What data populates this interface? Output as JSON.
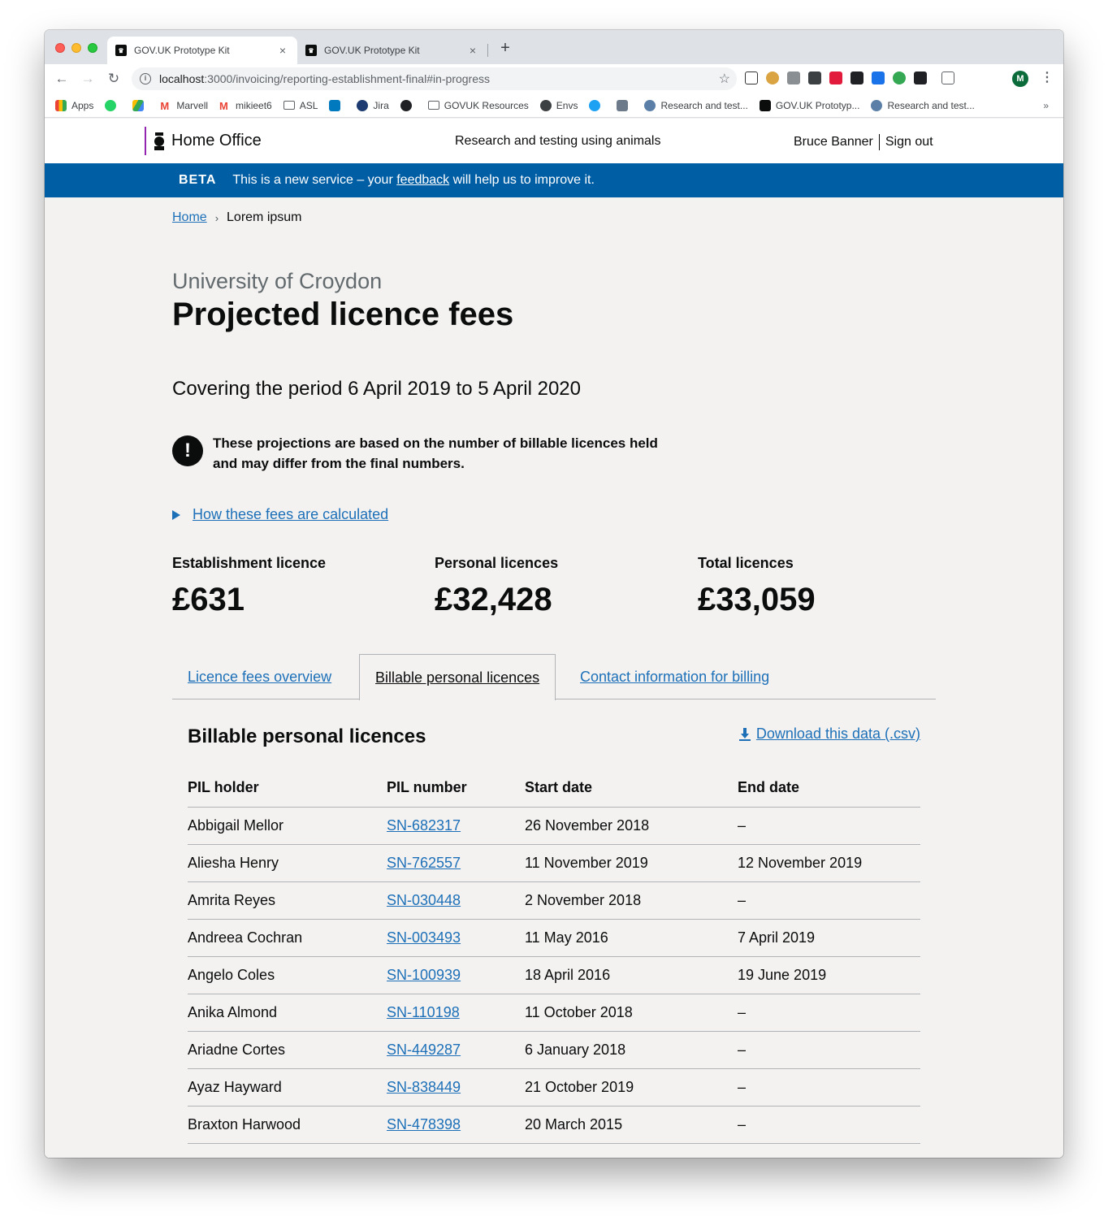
{
  "browser": {
    "tabs": [
      {
        "title": "GOV.UK Prototype Kit",
        "favicon": "crown-icon"
      },
      {
        "title": "GOV.UK Prototype Kit",
        "favicon": "crown-icon"
      }
    ],
    "close_glyph": "×",
    "new_tab_glyph": "+",
    "url_host": "localhost",
    "url_path": ":3000/invoicing/reporting-establishment-final#in-progress",
    "profile_initial": "M",
    "bookmarks": [
      "Apps",
      "Marvell",
      "mikieet6",
      "ASL",
      "Jira",
      "GOVUK Resources",
      "Envs",
      "Research and test...",
      "GOV.UK Prototyp...",
      "Research and test..."
    ],
    "bookmarks_more": "»"
  },
  "header": {
    "logo_text": "Home Office",
    "service_name": "Research and testing using animals",
    "user_name": "Bruce Banner",
    "sign_out": "Sign out"
  },
  "beta": {
    "tag": "BETA",
    "text_before": "This is a new service – your",
    "link": "feedback",
    "text_after": "will help us to improve it."
  },
  "breadcrumb": {
    "home": "Home",
    "current": "Lorem ipsum"
  },
  "page": {
    "caption": "University of Croydon",
    "title": "Projected licence fees",
    "period": "Covering the period 6 April 2019 to 5 April 2020",
    "warning_icon": "!",
    "warning": "These projections are based on the number of billable licences held and may differ from the final numbers.",
    "details_summary": "How these fees are calculated"
  },
  "stats": [
    {
      "label": "Establishment licence",
      "value": "£631"
    },
    {
      "label": "Personal licences",
      "value": "£32,428"
    },
    {
      "label": "Total licences",
      "value": "£33,059"
    }
  ],
  "tabs": [
    {
      "label": "Licence fees overview",
      "selected": false
    },
    {
      "label": "Billable personal licences",
      "selected": true
    },
    {
      "label": "Contact information for billing",
      "selected": false
    }
  ],
  "panel": {
    "heading": "Billable personal licences",
    "download": "Download this data (.csv)",
    "columns": [
      "PIL holder",
      "PIL number",
      "Start date",
      "End date"
    ],
    "rows": [
      [
        "Abbigail Mellor",
        "SN-682317",
        "26 November 2018",
        "–"
      ],
      [
        "Aliesha Henry",
        "SN-762557",
        "11 November 2019",
        "12 November 2019"
      ],
      [
        "Amrita Reyes",
        "SN-030448",
        "2 November 2018",
        "–"
      ],
      [
        "Andreea Cochran",
        "SN-003493",
        "11 May 2016",
        "7 April 2019"
      ],
      [
        "Angelo Coles",
        "SN-100939",
        "18 April 2016",
        "19 June 2019"
      ],
      [
        "Anika Almond",
        "SN-110198",
        "11 October 2018",
        "–"
      ],
      [
        "Ariadne Cortes",
        "SN-449287",
        "6 January 2018",
        "–"
      ],
      [
        "Ayaz Hayward",
        "SN-838449",
        "21 October 2019",
        "–"
      ],
      [
        "Braxton Harwood",
        "SN-478398",
        "20 March 2015",
        "–"
      ]
    ]
  },
  "colors": {
    "link": "#1d70b8",
    "beta_banner": "#005ea5",
    "page_bg": "#f3f2f1",
    "text": "#0b0c0c",
    "home_office_brand": "#9325b2"
  }
}
